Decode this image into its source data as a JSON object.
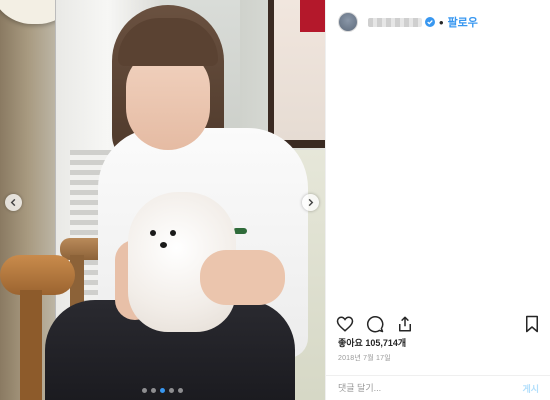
{
  "post": {
    "username_icon": "blurred-username",
    "verified_icon": "verified-badge-icon",
    "separator": "•",
    "follow_label": "팔로우",
    "likes_label": "좋아요 105,714개",
    "date": "2018년 7월 17일",
    "comment_placeholder": "댓글 달기...",
    "post_label": "게시"
  },
  "carousel": {
    "total_slides": 5,
    "active_slide": 3
  },
  "colors": {
    "accent": "#3897f0",
    "post_disabled": "#b2dffc",
    "text": "#262626",
    "muted": "#999999"
  },
  "icons": [
    "chevron-left-icon",
    "chevron-right-icon",
    "heart-icon",
    "comment-icon",
    "share-icon",
    "bookmark-icon"
  ]
}
